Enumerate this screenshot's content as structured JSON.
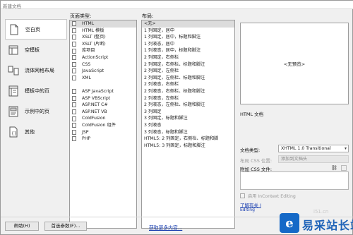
{
  "window": {
    "title": "新建文档"
  },
  "categories": [
    {
      "label": "空白页",
      "icon": "blank-page-icon",
      "selected": true
    },
    {
      "label": "空模板",
      "icon": "blank-template-icon",
      "selected": false
    },
    {
      "label": "流体网格布局",
      "icon": "fluid-grid-icon",
      "selected": false
    },
    {
      "label": "模板中的页",
      "icon": "template-page-icon",
      "selected": false
    },
    {
      "label": "示例中的页",
      "icon": "sample-page-icon",
      "selected": false
    },
    {
      "label": "其他",
      "icon": "other-icon",
      "selected": false
    }
  ],
  "page_types": {
    "header": "页面类型:",
    "items": [
      "HTML",
      "HTML 模板",
      "XSLT (整页)",
      "XSLT (片断)",
      "库项目",
      "ActionScript",
      "CSS",
      "JavaScript",
      "XML",
      "",
      "ASP JavaScript",
      "ASP VBScript",
      "ASP.NET C#",
      "ASP.NET VB",
      "ColdFusion",
      "ColdFusion 组件",
      "JSP",
      "PHP"
    ]
  },
  "layouts": {
    "header": "布局:",
    "items": [
      "<无>",
      "1 列固定，居中",
      "1 列固定，居中，标题和脚注",
      "1 列液态，居中",
      "1 列液态，居中，标题和脚注",
      "2 列固定，右侧栏",
      "2 列固定，右侧栏、标题和脚注",
      "2 列固定，左侧栏",
      "2 列固定，左侧栏、标题和脚注",
      "2 列液态，右侧栏",
      "2 列液态，右侧栏、标题和脚注",
      "2 列液态，左侧栏",
      "2 列液态，左侧栏、标题和脚注",
      "3 列固定",
      "3 列固定，标题和脚注",
      "3 列液态",
      "3 列液态，标题和脚注",
      "HTML5: 2 列固定，右侧栏、标题和脚",
      "HTML5: 3 列固定，标题和脚注"
    ]
  },
  "preview": {
    "text": "<无预览>"
  },
  "description": "HTML 文档",
  "doctype": {
    "label": "文档类型:",
    "value": "XHTML 1.0 Transitional"
  },
  "layout_css": {
    "label": "布局 CSS 位置:",
    "value": "添加到文档头"
  },
  "attach_css": {
    "label": "附加 CSS 文件:",
    "link_icon": "link-icon"
  },
  "incontext": {
    "label": "启用 InContext Editing"
  },
  "learn_more": {
    "line1": "了解有关 I",
    "line2": "Editing"
  },
  "buttons": {
    "help": "帮助(H)",
    "prefs": "首选参数(F)...",
    "get_more": "获取更多内容..."
  },
  "watermark": {
    "text": "易采站长站",
    "small": "i51.cn",
    "logo_letter": "e"
  }
}
